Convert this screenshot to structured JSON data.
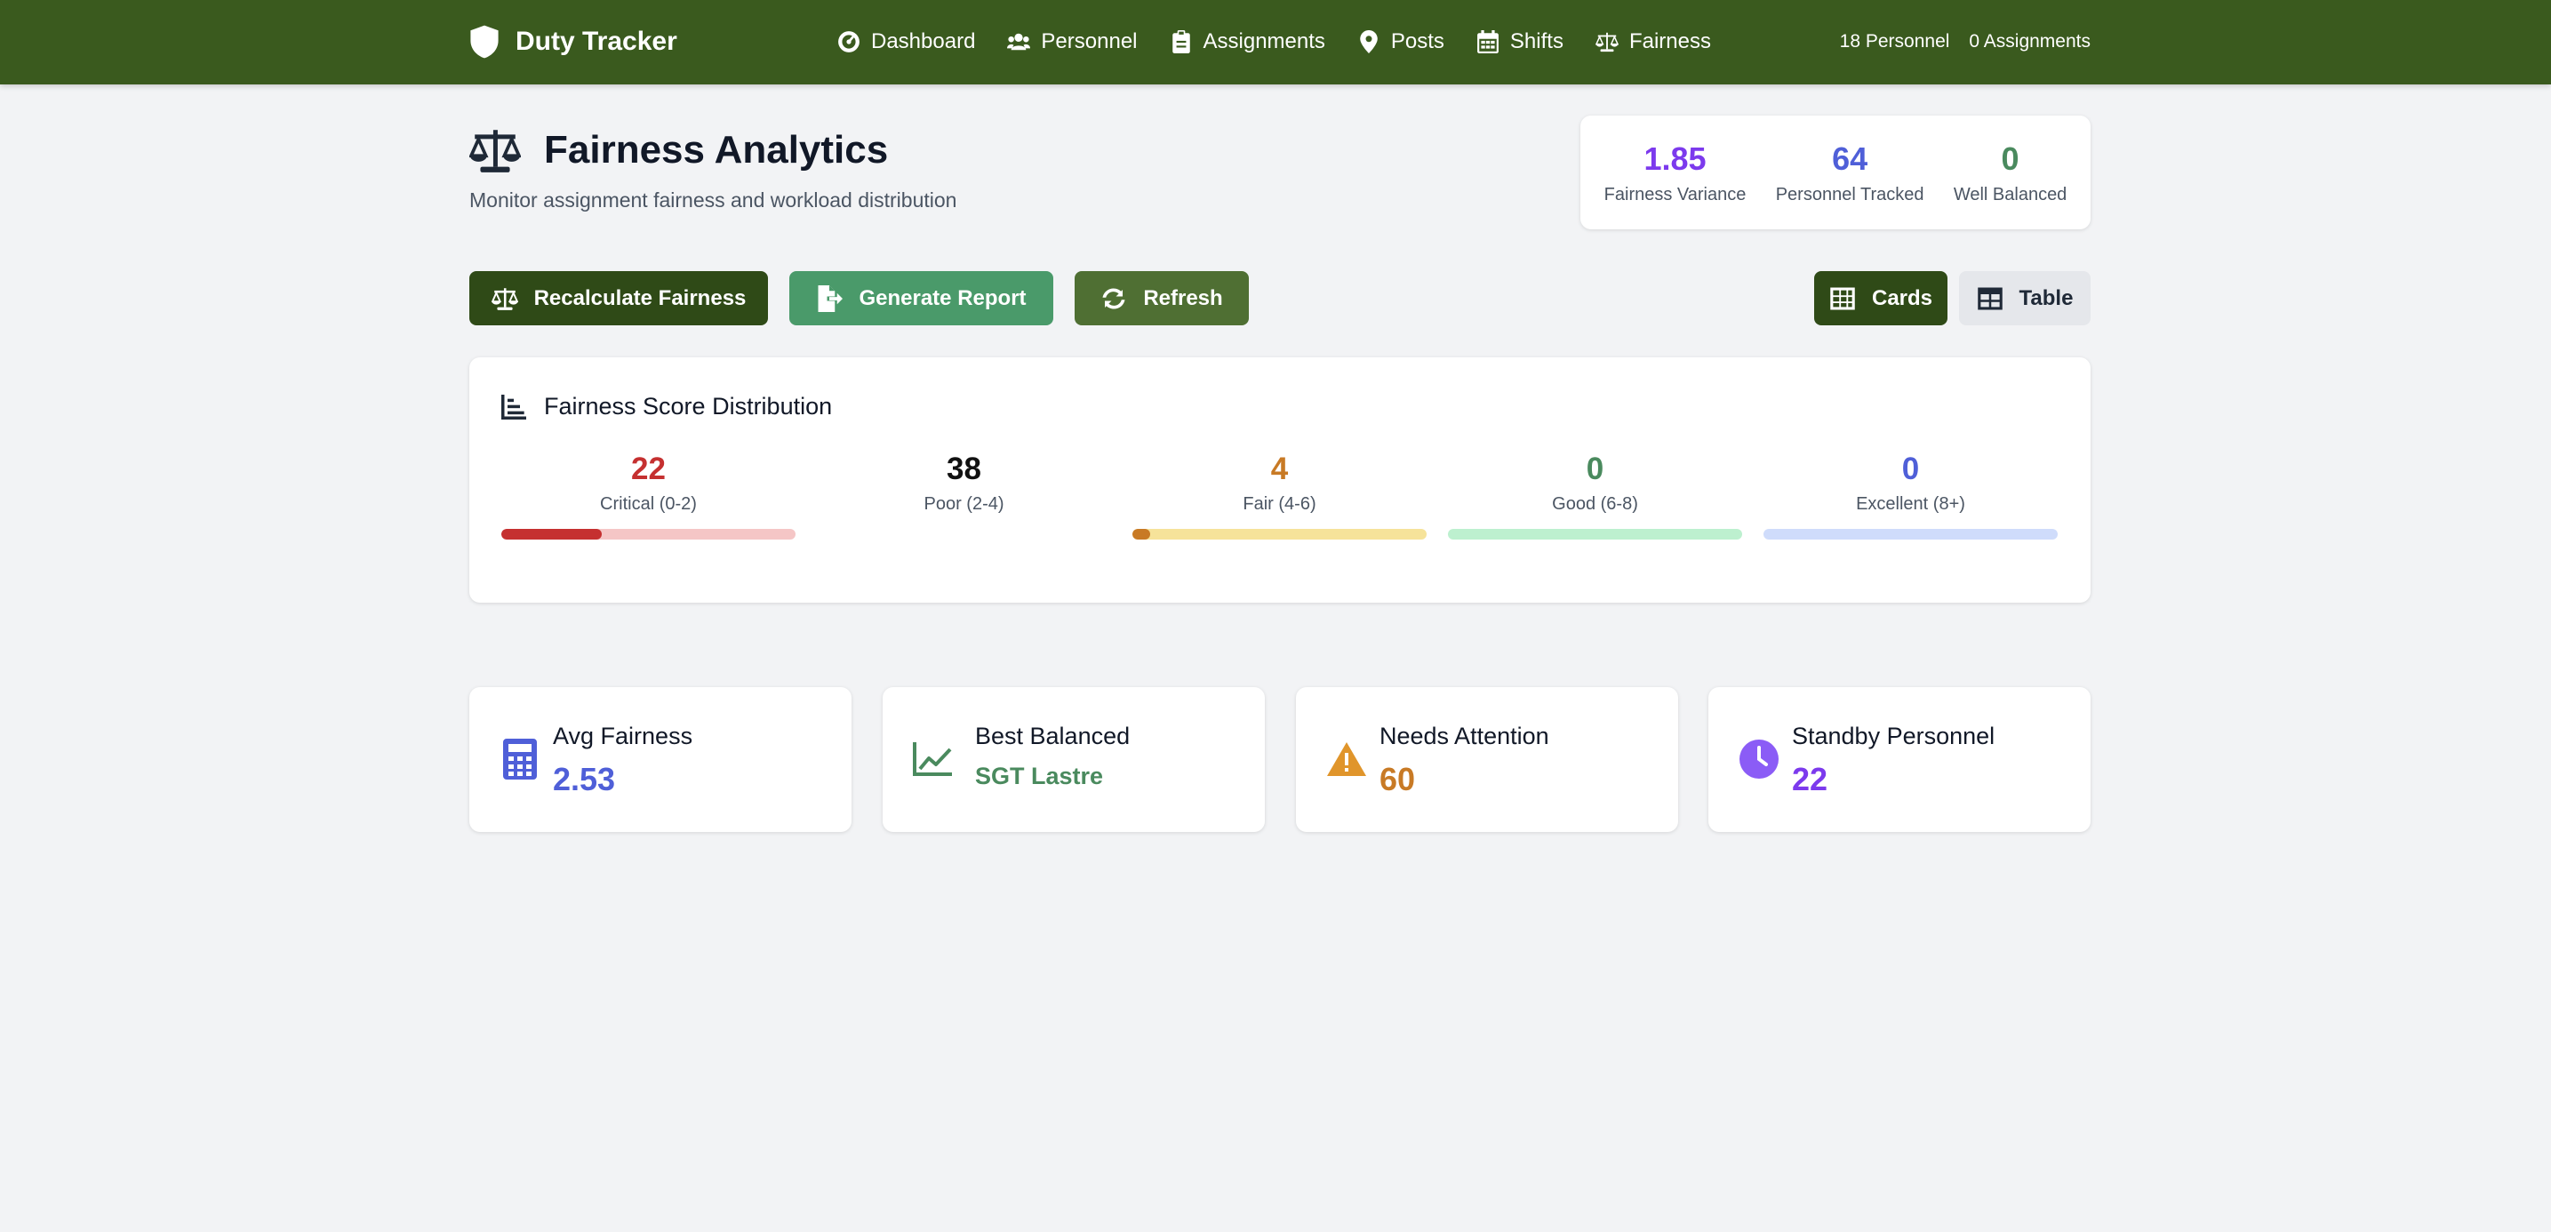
{
  "brand": {
    "name": "Duty Tracker"
  },
  "nav": {
    "links": [
      {
        "label": "Dashboard",
        "icon": "gauge-icon"
      },
      {
        "label": "Personnel",
        "icon": "users-icon"
      },
      {
        "label": "Assignments",
        "icon": "clipboard-icon"
      },
      {
        "label": "Posts",
        "icon": "map-pin-icon"
      },
      {
        "label": "Shifts",
        "icon": "calendar-icon"
      },
      {
        "label": "Fairness",
        "icon": "scale-icon"
      }
    ],
    "personnel_count": "18 Personnel",
    "assignments_count": "0 Assignments"
  },
  "header": {
    "title": "Fairness Analytics",
    "subtitle": "Monitor assignment fairness and workload distribution"
  },
  "summary": [
    {
      "value": "1.85",
      "label": "Fairness Variance",
      "color": "#7c3aed"
    },
    {
      "value": "64",
      "label": "Personnel Tracked",
      "color": "#4f5fd8"
    },
    {
      "value": "0",
      "label": "Well Balanced",
      "color": "#4a8a5e"
    }
  ],
  "actions": {
    "recalculate": "Recalculate Fairness",
    "report": "Generate Report",
    "refresh": "Refresh",
    "cards_view": "Cards",
    "table_view": "Table"
  },
  "distribution": {
    "title": "Fairness Score Distribution",
    "buckets": [
      {
        "count": "22",
        "label": "Critical (0-2)",
        "color": "#c53030",
        "track": "#f5c6c6",
        "fill_fraction": 0.34,
        "show_bar": true
      },
      {
        "count": "38",
        "label": "Poor (2-4)",
        "color": "#111111",
        "track": "#ffffff",
        "fill_fraction": 0,
        "show_bar": false
      },
      {
        "count": "4",
        "label": "Fair (4-6)",
        "color": "#c87a25",
        "track": "#f6e39a",
        "fill_fraction": 0.06,
        "show_bar": true
      },
      {
        "count": "0",
        "label": "Good (6-8)",
        "color": "#4a8a5e",
        "track": "#bdf0cf",
        "fill_fraction": 0,
        "show_bar": true
      },
      {
        "count": "0",
        "label": "Excellent (8+)",
        "color": "#4f5fd8",
        "track": "#cfdcfb",
        "fill_fraction": 0,
        "show_bar": true
      }
    ]
  },
  "stats": [
    {
      "label": "Avg Fairness",
      "value": "2.53",
      "color": "#4f5fd8",
      "icon": "calculator-icon"
    },
    {
      "label": "Best Balanced",
      "value": "SGT Lastre",
      "color": "#4a8a5e",
      "icon": "line-chart-icon"
    },
    {
      "label": "Needs Attention",
      "value": "60",
      "color": "#c87a25",
      "icon": "warning-icon"
    },
    {
      "label": "Standby Personnel",
      "value": "22",
      "color": "#7c3aed",
      "icon": "clock-icon"
    }
  ]
}
